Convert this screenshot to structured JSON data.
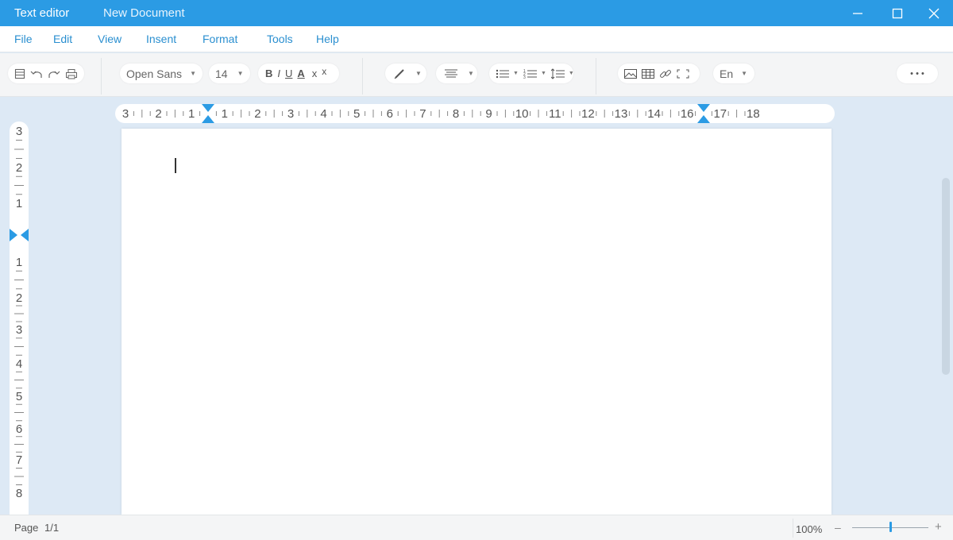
{
  "window": {
    "app_title": "Text editor",
    "document_title": "New Document"
  },
  "menu": [
    "File",
    "Edit",
    "View",
    "Insent",
    "Format",
    "Tools",
    "Help"
  ],
  "toolbar": {
    "font_family": "Open Sans",
    "font_size": "14",
    "bold": "B",
    "italic": "I",
    "underline": "U",
    "text_color": "A",
    "subscript": "x",
    "superscript": "x",
    "language": "En",
    "more": "• • •",
    "caret": "▼"
  },
  "ruler": {
    "h_labels": [
      "3",
      "2",
      "1",
      "1",
      "2",
      "3",
      "4",
      "5",
      "6",
      "7",
      "8",
      "9",
      "10",
      "11",
      "12",
      "13",
      "14",
      "16",
      "17",
      "18"
    ],
    "v_labels": [
      "3",
      "2",
      "1",
      "1",
      "2",
      "3",
      "4",
      "5",
      "6",
      "7",
      "8"
    ]
  },
  "status": {
    "page_label": "Page",
    "page_value": "1/1",
    "zoom": "100%",
    "zoom_level": 0.5,
    "zoom_minus": "–",
    "zoom_plus": "+"
  },
  "colors": {
    "accent": "#2b9be4",
    "menu_text": "#2a8fd0",
    "workspace": "#dde9f5"
  }
}
